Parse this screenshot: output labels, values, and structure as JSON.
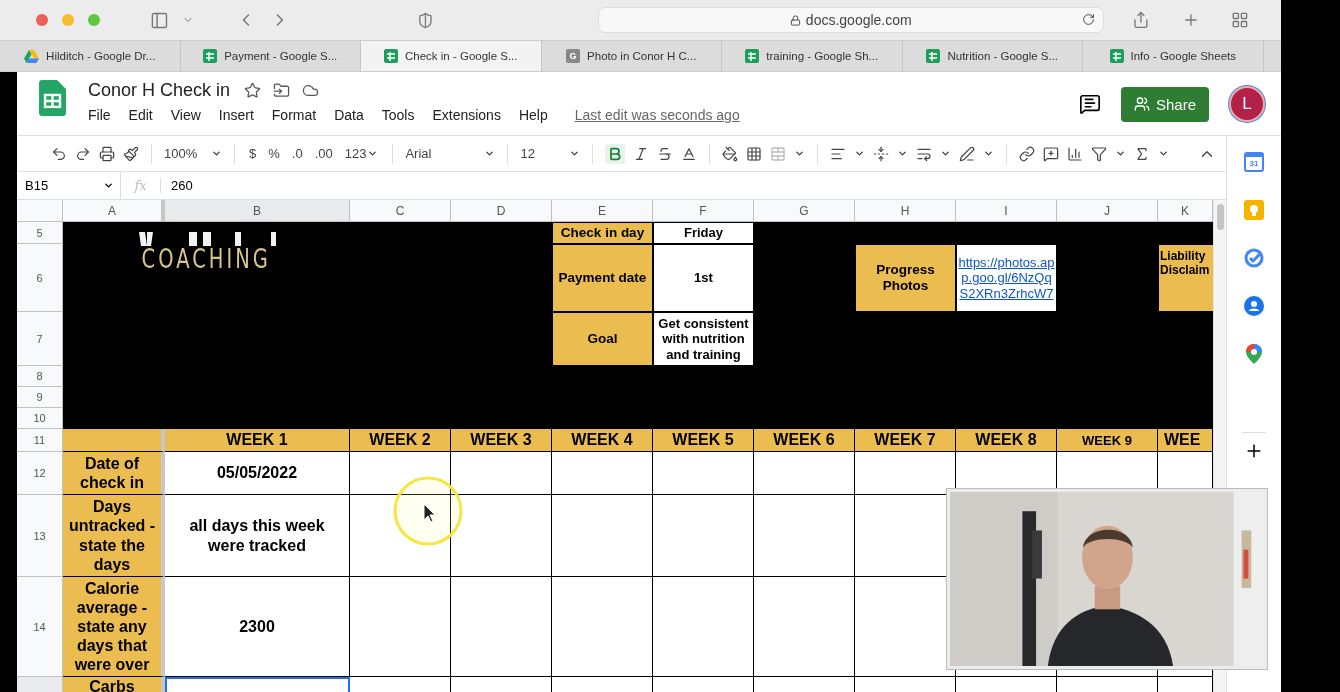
{
  "browser": {
    "address": "docs.google.com",
    "tabs": [
      {
        "label": "Hilditch - Google Dr...",
        "kind": "drive",
        "selected": false
      },
      {
        "label": "Payment - Google S...",
        "kind": "sheets",
        "selected": false
      },
      {
        "label": "Check in - Google S...",
        "kind": "sheets",
        "selected": true
      },
      {
        "label": "Photo in Conor H C...",
        "kind": "letter",
        "icon_text": "G",
        "selected": false
      },
      {
        "label": "training - Google Sh...",
        "kind": "sheets",
        "selected": false
      },
      {
        "label": "Nutrition - Google S...",
        "kind": "sheets",
        "selected": false
      },
      {
        "label": "Info - Google Sheets",
        "kind": "sheets",
        "selected": false
      }
    ]
  },
  "document": {
    "title": "Conor H Check in",
    "last_edit": "Last edit was seconds ago",
    "share": "Share",
    "avatar": "L"
  },
  "menu": [
    "File",
    "Edit",
    "View",
    "Insert",
    "Format",
    "Data",
    "Tools",
    "Extensions",
    "Help"
  ],
  "toolbar": {
    "zoom": "100%",
    "currency": "$",
    "percent": "%",
    "decimal_less": ".0",
    "decimal_more": ".00",
    "number_format": "123",
    "font": "Arial",
    "font_size": "12",
    "bold": true
  },
  "formula_bar": {
    "cell": "B15",
    "fx_label": "fx",
    "value": "260"
  },
  "side_panel": {
    "calendar_day": "31"
  },
  "sheet": {
    "columns": [
      {
        "label": "A",
        "selected": false
      },
      {
        "label": "B",
        "selected": true
      },
      {
        "label": "C",
        "selected": false
      },
      {
        "label": "D",
        "selected": false
      },
      {
        "label": "E",
        "selected": false
      },
      {
        "label": "F",
        "selected": false
      },
      {
        "label": "G",
        "selected": false
      },
      {
        "label": "H",
        "selected": false
      },
      {
        "label": "I",
        "selected": false
      },
      {
        "label": "J",
        "selected": false
      },
      {
        "label": "K",
        "selected": false
      }
    ],
    "row_numbers": [
      "5",
      "6",
      "7",
      "8",
      "9",
      "10",
      "11",
      "12",
      "13",
      "14"
    ],
    "logo_text": "COACHING",
    "info": [
      {
        "label": "Check in day",
        "value": "Friday"
      },
      {
        "label": "Payment date",
        "value": "1st"
      },
      {
        "label": "Goal",
        "value": "Get consistent with nutrition and training"
      }
    ],
    "progress": {
      "label": "Progress Photos",
      "link": "https://photos.app.goo.gl/6NzQqS2XRn3ZrhcW7"
    },
    "disclaimer": "Liability Disclaim",
    "weeks": [
      "WEEK 1",
      "WEEK 2",
      "WEEK 3",
      "WEEK 4",
      "WEEK 5",
      "WEEK 6",
      "WEEK 7",
      "WEEK 8",
      "WEEK 9",
      "WEE"
    ],
    "rows": [
      {
        "label": "Date of check in",
        "values": [
          "05/05/2022"
        ],
        "selected": false
      },
      {
        "label": "Days untracked - state the days",
        "values": [
          "all days this week were tracked"
        ],
        "selected": false
      },
      {
        "label": "Calorie average - state any days that were over",
        "values": [
          "2300"
        ],
        "selected": false
      },
      {
        "label": "Carbs",
        "values": [],
        "selected": true
      }
    ]
  },
  "video_overlay": {
    "kind": "picture"
  }
}
